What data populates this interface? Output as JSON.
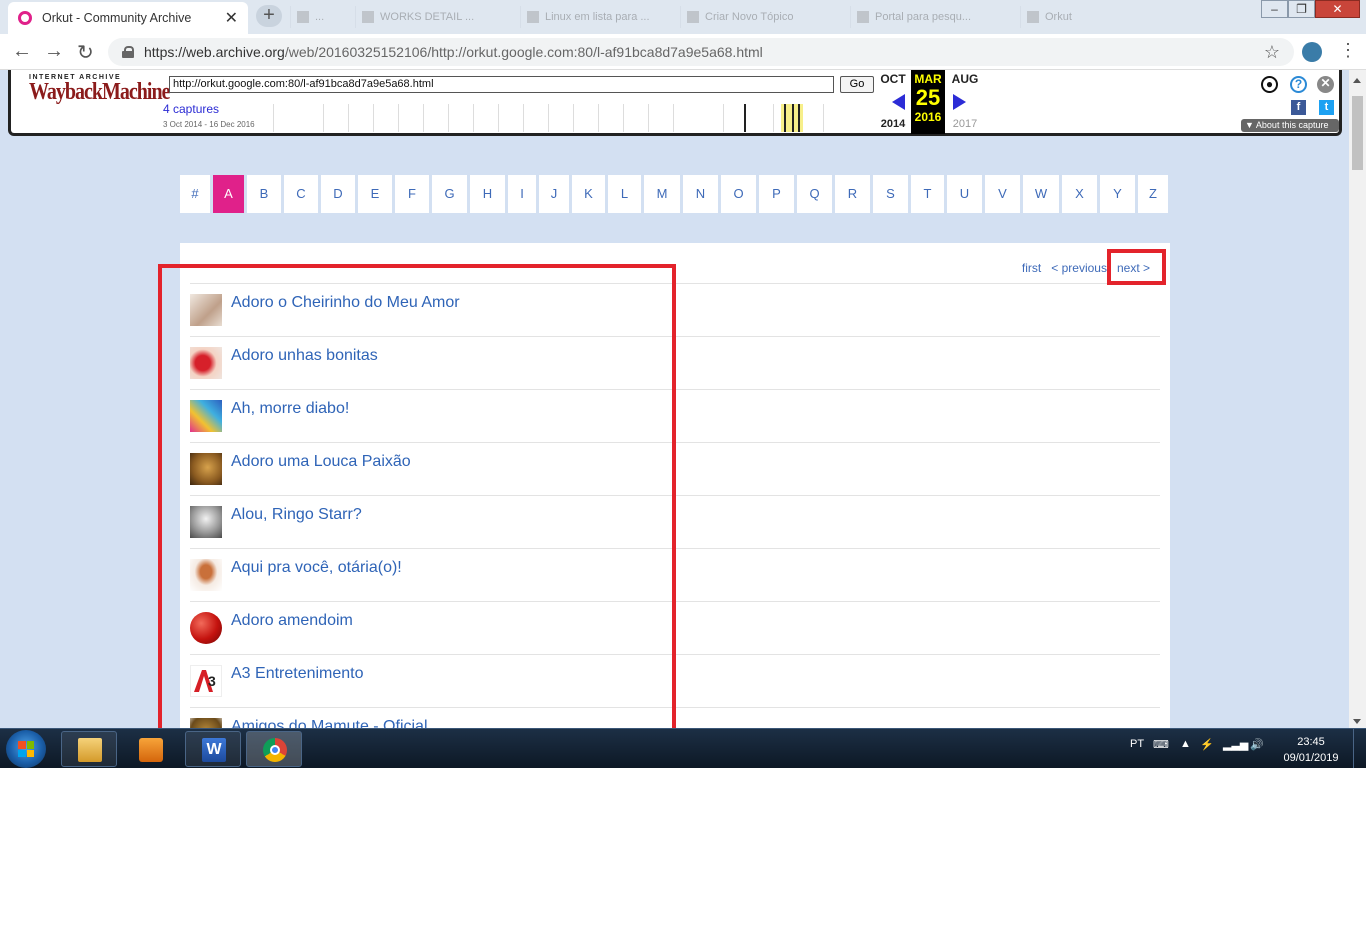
{
  "browser": {
    "tab_title": "Orkut - Community Archive",
    "background_tabs": [
      "...",
      "WORKS DETAIL ...",
      "Linux em lista para ...",
      "Criar Novo Tópico",
      "Portal para pesqu...",
      "Orkut"
    ],
    "url_host": "https://web.archive.org",
    "url_path": "/web/20160325152106/http://orkut.google.com:80/l-af91bca8d7a9e5a68.html"
  },
  "wayback": {
    "logo_top": "INTERNET ARCHIVE",
    "logo_main": "WaybackMachine",
    "input_value": "http://orkut.google.com:80/l-af91bca8d7a9e5a68.html",
    "go_label": "Go",
    "captures": "4 captures",
    "range": "3 Oct 2014 - 16 Dec 2016",
    "prev_month": "OCT",
    "cur_month": "MAR",
    "next_month": "AUG",
    "cur_day": "25",
    "prev_year": "2014",
    "cur_year": "2016",
    "next_year": "2017",
    "about": "About this capture"
  },
  "alphabet": {
    "letters": [
      "#",
      "A",
      "B",
      "C",
      "D",
      "E",
      "F",
      "G",
      "H",
      "I",
      "J",
      "K",
      "L",
      "M",
      "N",
      "O",
      "P",
      "Q",
      "R",
      "S",
      "T",
      "U",
      "V",
      "W",
      "X",
      "Y",
      "Z"
    ],
    "active": "A"
  },
  "pager": {
    "first": "first",
    "previous": "< previous",
    "next": "next >"
  },
  "communities": [
    "Adoro o Cheirinho do Meu Amor",
    "Adoro unhas bonitas",
    "Ah, morre diabo!",
    "Adoro uma Louca Paixão",
    "Alou, Ringo Starr?",
    "Aqui pra você, otária(o)!",
    "Adoro amendoim",
    "A3 Entretenimento",
    "Amigos do Mamute - Oficial"
  ],
  "taskbar": {
    "lang": "PT",
    "time": "23:45",
    "date": "09/01/2019"
  },
  "colors": {
    "accent_pink": "#e0218a",
    "link_blue": "#2f64b7",
    "annotation_red": "#e3232b",
    "page_bg": "#d3e0f2"
  }
}
